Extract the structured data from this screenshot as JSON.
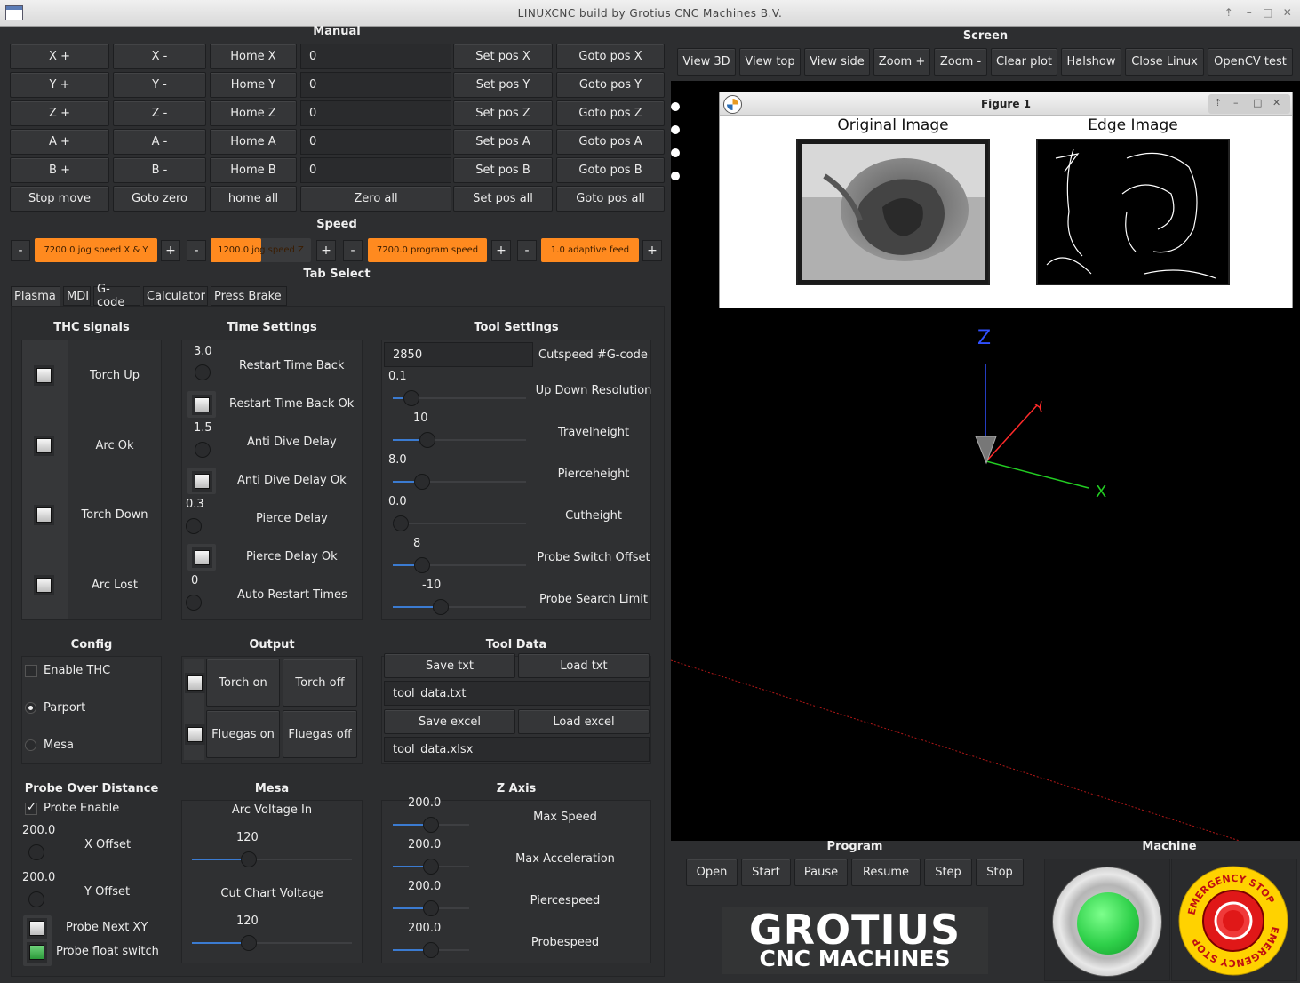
{
  "window": {
    "title": "LINUXCNC build by Grotius CNC Machines B.V."
  },
  "manual": {
    "title": "Manual",
    "rows": [
      {
        "plus": "X +",
        "minus": "X -",
        "home": "Home X",
        "value": "0",
        "set": "Set pos X",
        "goto": "Goto pos X"
      },
      {
        "plus": "Y +",
        "minus": "Y -",
        "home": "Home Y",
        "value": "0",
        "set": "Set pos Y",
        "goto": "Goto pos Y"
      },
      {
        "plus": "Z +",
        "minus": "Z -",
        "home": "Home Z",
        "value": "0",
        "set": "Set pos Z",
        "goto": "Goto pos Z"
      },
      {
        "plus": "A +",
        "minus": "A -",
        "home": "Home A",
        "value": "0",
        "set": "Set pos A",
        "goto": "Goto pos A"
      },
      {
        "plus": "B +",
        "minus": "B -",
        "home": "Home B",
        "value": "0",
        "set": "Set pos B",
        "goto": "Goto pos B"
      }
    ],
    "bottom": {
      "stop": "Stop move",
      "goto_zero": "Goto zero",
      "home_all": "home all",
      "zero_all": "Zero all",
      "set_all": "Set pos all",
      "goto_all": "Goto pos all"
    }
  },
  "speed": {
    "title": "Speed",
    "minus": "-",
    "plus": "+",
    "jog_xy": "7200.0 jog speed X & Y",
    "jog_z": "1200.0 jog speed Z",
    "program": "7200.0 program speed",
    "adaptive": "1.0 adaptive feed",
    "jog_z_fraction": 0.5
  },
  "tabs": {
    "title": "Tab Select",
    "items": [
      "Plasma",
      "MDI",
      "G-code",
      "Calculator",
      "Press Brake"
    ],
    "active": "Plasma"
  },
  "thc": {
    "title": "THC signals",
    "items": [
      "Torch Up",
      "Arc Ok",
      "Torch Down",
      "Arc Lost"
    ]
  },
  "time_settings": {
    "title": "Time Settings",
    "restart_time_back": {
      "value": "3.0",
      "label": "Restart Time Back"
    },
    "restart_time_back_ok": "Restart Time Back Ok",
    "anti_dive_delay": {
      "value": "1.5",
      "label": "Anti Dive Delay"
    },
    "anti_dive_delay_ok": "Anti Dive Delay Ok",
    "pierce_delay": {
      "value": "0.3",
      "label": "Pierce Delay"
    },
    "pierce_delay_ok": "Pierce Delay Ok",
    "auto_restart": {
      "value": "0",
      "label": "Auto Restart Times"
    }
  },
  "tool_settings": {
    "title": "Tool Settings",
    "cutspeed": {
      "value": "2850",
      "label": "Cutspeed #G-code"
    },
    "sliders": [
      {
        "value": "0.1",
        "label": "Up Down Resolution",
        "fraction": 0.08
      },
      {
        "value": "10",
        "label": "Travelheight",
        "fraction": 0.2
      },
      {
        "value": "8.0",
        "label": "Pierceheight",
        "fraction": 0.16
      },
      {
        "value": "0.0",
        "label": "Cutheight",
        "fraction": 0.0
      },
      {
        "value": "8",
        "label": "Probe Switch Offset",
        "fraction": 0.16
      },
      {
        "value": "-10",
        "label": "Probe Search Limit",
        "fraction": 0.3
      }
    ]
  },
  "config": {
    "title": "Config",
    "enable_thc": "Enable THC",
    "parport": "Parport",
    "mesa": "Mesa",
    "selected": "Parport"
  },
  "output": {
    "title": "Output",
    "torch_on": "Torch on",
    "torch_off": "Torch off",
    "fluegas_on": "Fluegas on",
    "fluegas_off": "Fluegas off"
  },
  "tool_data": {
    "title": "Tool Data",
    "save_txt": "Save txt",
    "load_txt": "Load txt",
    "txt_file": "tool_data.txt",
    "save_excel": "Save excel",
    "load_excel": "Load excel",
    "xlsx_file": "tool_data.xlsx"
  },
  "probe": {
    "title": "Probe Over Distance",
    "enable": "Probe Enable",
    "x_offset": {
      "value": "200.0",
      "label": "X Offset"
    },
    "y_offset": {
      "value": "200.0",
      "label": "Y Offset"
    },
    "next_xy": "Probe Next XY",
    "float_switch": "Probe float switch"
  },
  "mesa": {
    "title": "Mesa",
    "arc_voltage": {
      "label": "Arc Voltage In",
      "value": "120",
      "fraction": 0.35
    },
    "cut_chart": {
      "label": "Cut Chart Voltage",
      "value": "120",
      "fraction": 0.35
    }
  },
  "z_axis": {
    "title": "Z Axis",
    "sliders": [
      {
        "value": "200.0",
        "label": "Max Speed",
        "fraction": 0.4
      },
      {
        "value": "200.0",
        "label": "Max Acceleration",
        "fraction": 0.4
      },
      {
        "value": "200.0",
        "label": "Piercespeed",
        "fraction": 0.4
      },
      {
        "value": "200.0",
        "label": "Probespeed",
        "fraction": 0.4
      }
    ]
  },
  "screen": {
    "title": "Screen",
    "buttons": [
      "View 3D",
      "View top",
      "View side",
      "Zoom +",
      "Zoom -",
      "Clear plot",
      "Halshow",
      "Close Linux",
      "OpenCV test"
    ]
  },
  "figure": {
    "title": "Figure 1",
    "original": "Original Image",
    "edge": "Edge Image"
  },
  "axes": {
    "z": "Z",
    "y": "Y",
    "x": "X"
  },
  "program": {
    "title": "Program",
    "buttons": [
      "Open",
      "Start",
      "Pause",
      "Resume",
      "Step",
      "Stop"
    ]
  },
  "logo": {
    "line1": "GROTIUS",
    "line2": "CNC MACHINES"
  },
  "machine": {
    "title": "Machine",
    "estop_text": "EMERGENCY STOP"
  },
  "colors": {
    "accent_orange": "#ff8a1f",
    "slider_blue": "#3b7bd1",
    "green_button": "#2fd04a",
    "estop_red": "#e01818",
    "estop_yellow": "#ffd200"
  }
}
